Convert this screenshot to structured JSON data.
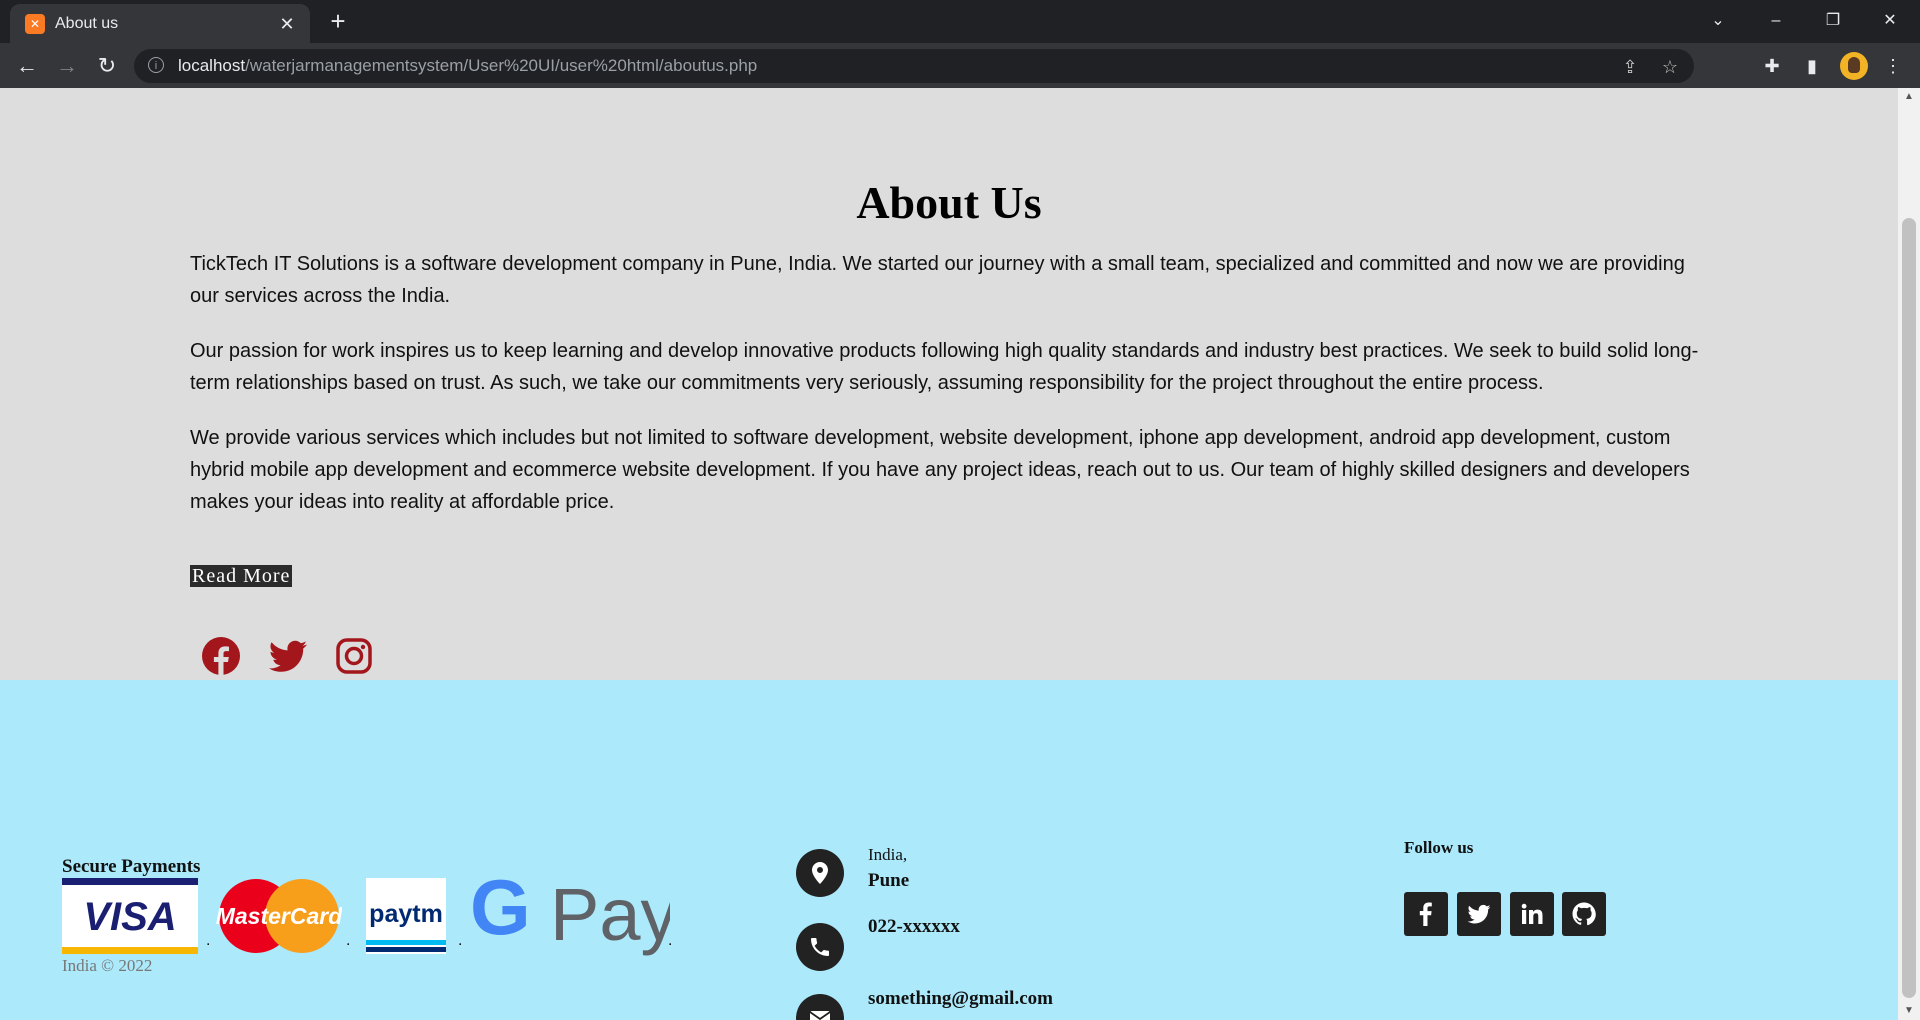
{
  "browser": {
    "tab_title": "About us",
    "url_host": "localhost",
    "url_path": "/waterjarmanagementsystem/User%20UI/user%20html/aboutus.php"
  },
  "about": {
    "heading": "About Us",
    "paragraphs": [
      "TickTech IT Solutions is a software development company in Pune, India. We started our journey with a small team, specialized and committed and now we are providing our services across the India.",
      "Our passion for work inspires us to keep learning and develop innovative products following high quality standards and industry best practices. We seek to build solid long-term relationships based on trust. As such, we take our commitments very seriously, assuming responsibility for the project throughout the entire process.",
      "We provide various services which includes but not limited to software development, website development, iphone app development, android app development, custom hybrid mobile app development and ecommerce website development. If you have any project ideas, reach out to us. Our team of highly skilled designers and developers makes your ideas into reality at affordable price."
    ],
    "read_more": "Read More",
    "social_icons": [
      "facebook-icon",
      "twitter-icon",
      "instagram-icon"
    ],
    "social_color": "#a3161b"
  },
  "footer": {
    "payments_title": "Secure Payments",
    "payment_logos": {
      "visa": "VISA",
      "mastercard": "MasterCard",
      "paytm": "paytm",
      "gpay_g": "G",
      "gpay_pay": "Pay"
    },
    "separator": ".",
    "copyright": "India © 2022",
    "address_line1": "India,",
    "address_line2": "Pune",
    "phone": "022-xxxxxx",
    "email": "something@gmail.com",
    "follow_title": "Follow us",
    "follow_icons": [
      "facebook-icon",
      "twitter-icon",
      "linkedin-icon",
      "github-icon"
    ],
    "background": "#abe9fb"
  }
}
